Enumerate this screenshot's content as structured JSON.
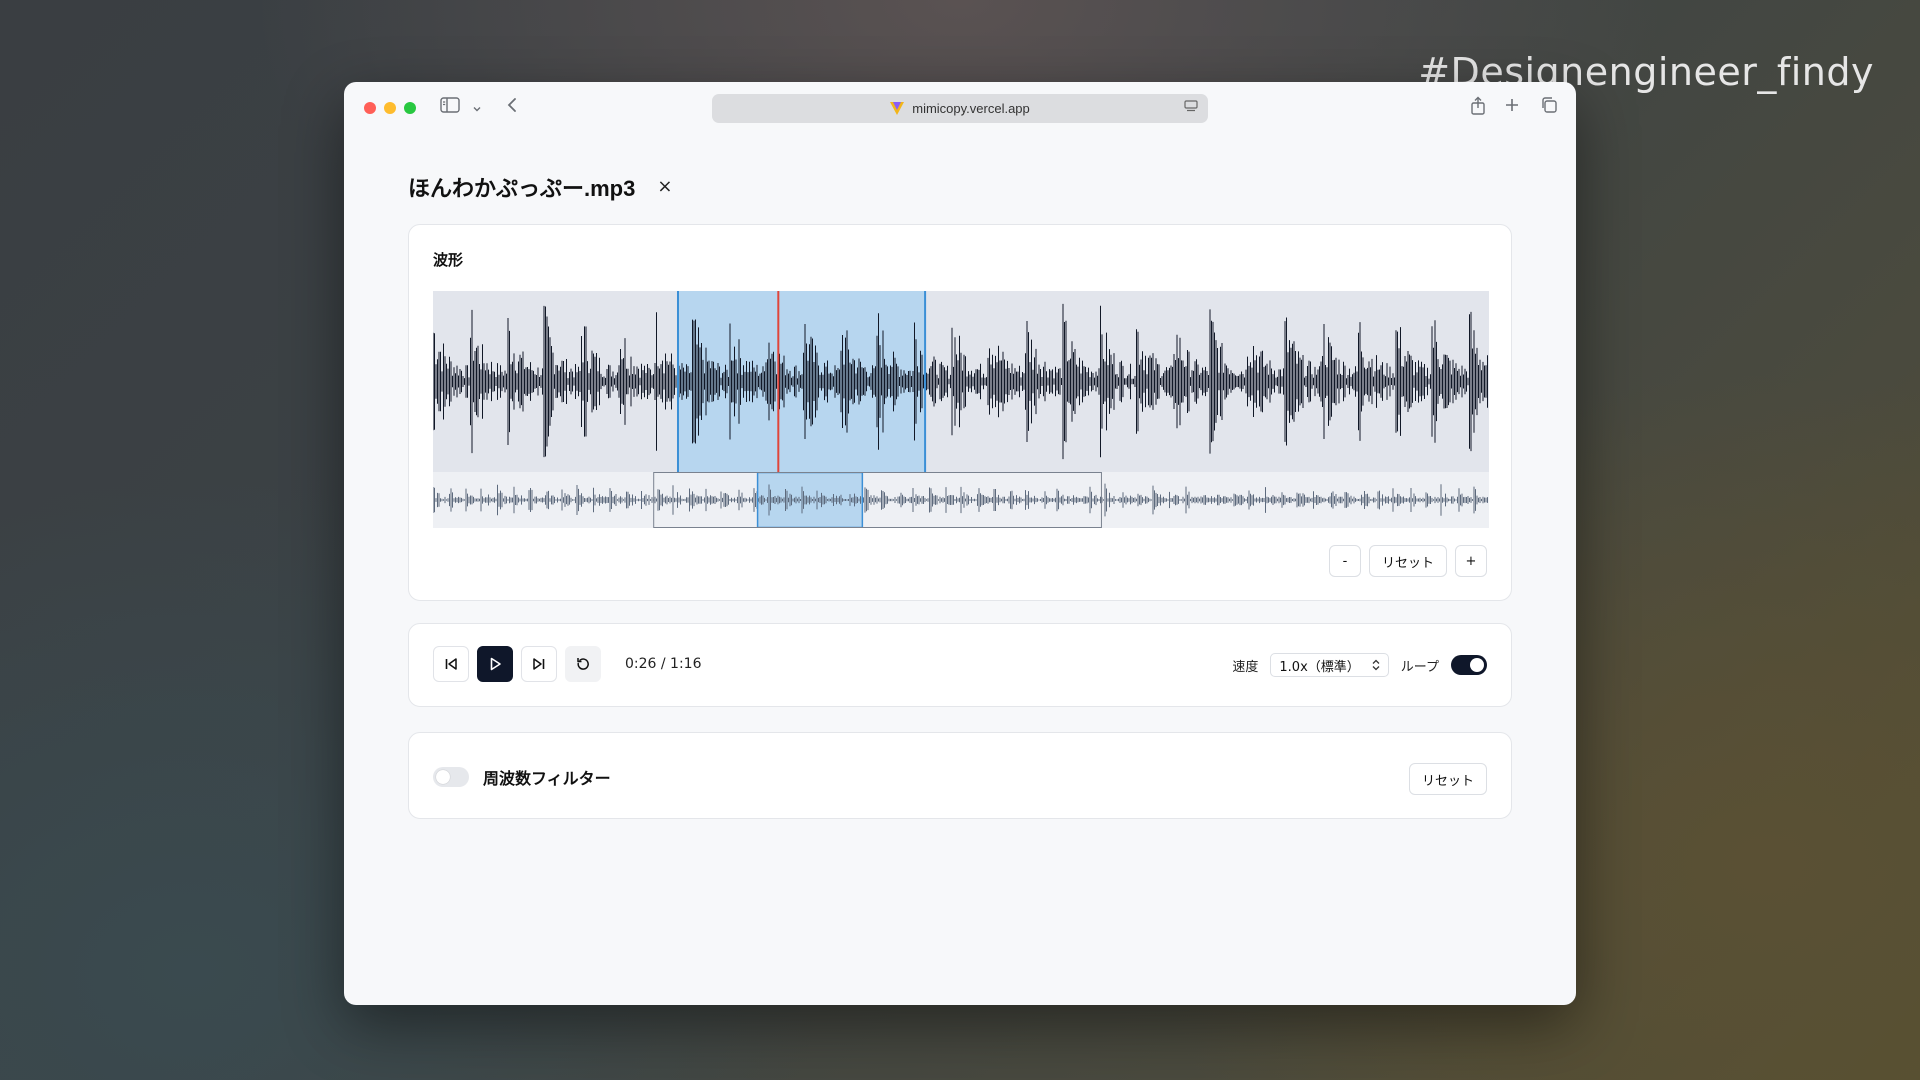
{
  "overlay": {
    "hashtag": "#Designengineer_findy"
  },
  "browser": {
    "url": "mimicopy.vercel.app"
  },
  "file": {
    "name": "ほんわかぷっぷー.mp3",
    "close_label": "×"
  },
  "waveform": {
    "title": "波形",
    "zoom_out_label": "-",
    "zoom_reset_label": "リセット",
    "zoom_in_label": "+",
    "loop_region": {
      "start": 0.232,
      "end": 0.466
    },
    "playhead": 0.327,
    "view_window": {
      "start": 0.209,
      "end": 0.633
    },
    "colors": {
      "wave": "#111827",
      "mini_wave": "#5d6a7d",
      "region": "#b7d6ef",
      "region_edge": "#3b8fd6",
      "playhead": "#e0453a"
    }
  },
  "player": {
    "time": "0:26 / 1:16",
    "speed_label": "速度",
    "speed_value": "1.0x（標準）",
    "loop_label": "ループ",
    "loop_on": true,
    "icons": [
      "skip-back-icon",
      "play-icon",
      "skip-forward-icon",
      "restart-icon"
    ]
  },
  "filter": {
    "label": "周波数フィルター",
    "enabled": false,
    "reset_label": "リセット"
  }
}
